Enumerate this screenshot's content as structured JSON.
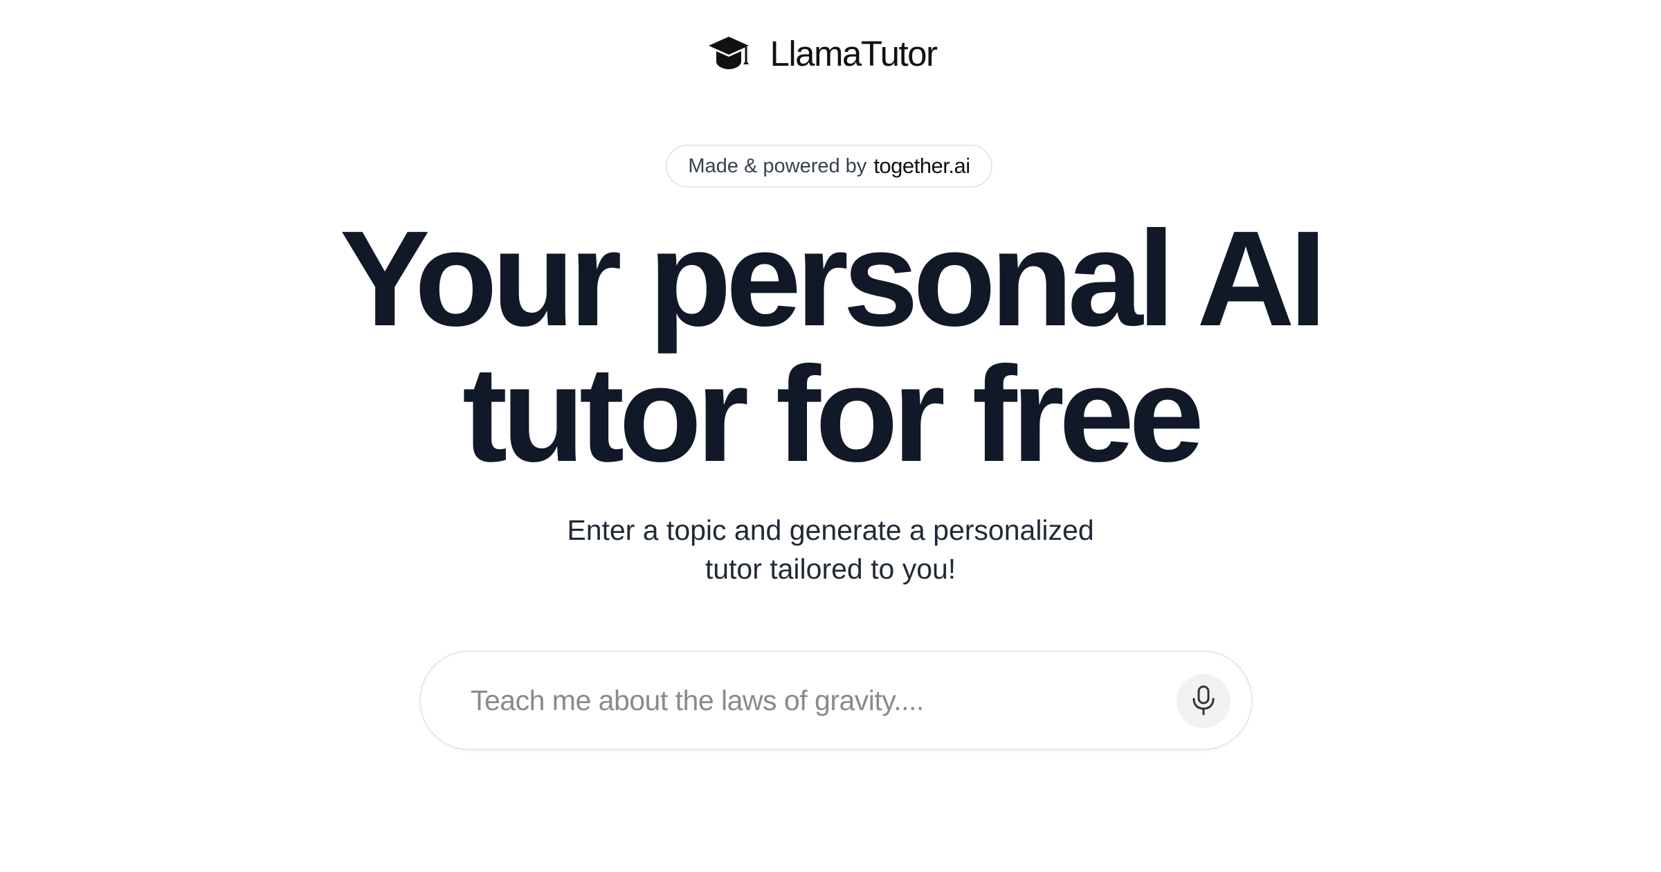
{
  "header": {
    "app_name": "LlamaTutor",
    "logo_icon": "graduation-cap-icon"
  },
  "badge": {
    "text": "Made & powered by",
    "brand": "together.ai"
  },
  "hero": {
    "line1": "Your personal AI",
    "line2": "tutor for free"
  },
  "subtitle": {
    "line1": "Enter a topic and generate a personalized",
    "line2": "tutor tailored to you!"
  },
  "search": {
    "placeholder": "Teach me about the laws of gravity....",
    "value": "",
    "mic_icon": "microphone-icon"
  },
  "colors": {
    "text_dark": "#111827",
    "border": "#e5e7eb",
    "mic_bg": "#f1f1f1"
  }
}
